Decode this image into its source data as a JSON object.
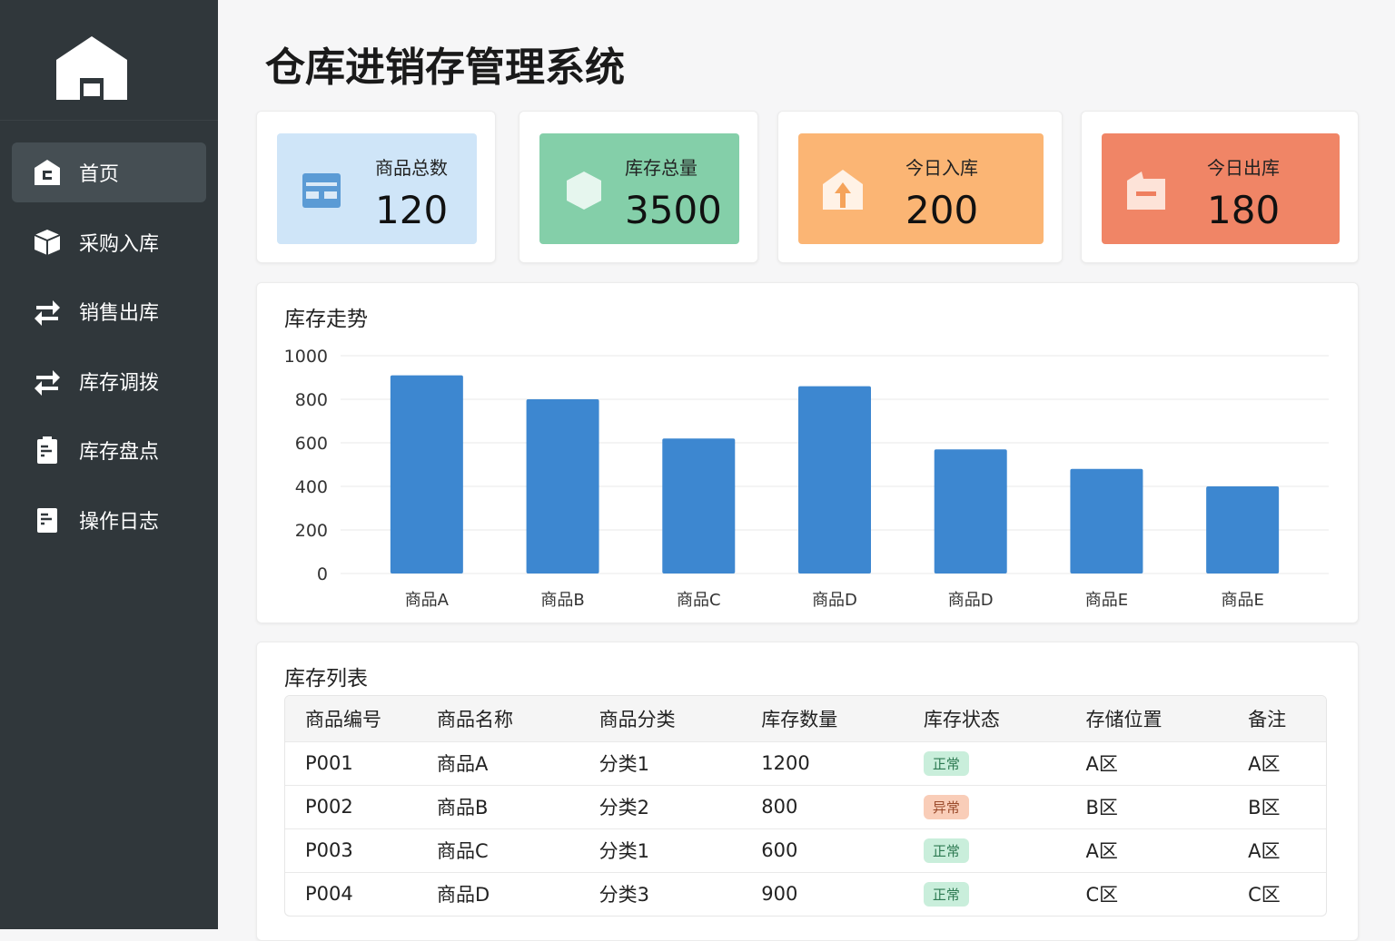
{
  "app": {
    "title": "仓库进销存管理系统"
  },
  "sidebar": {
    "items": [
      {
        "label": "首页",
        "icon": "home-icon"
      },
      {
        "label": "采购入库",
        "icon": "box-icon"
      },
      {
        "label": "销售出库",
        "icon": "transfer-icon"
      },
      {
        "label": "库存调拨",
        "icon": "transfer-icon"
      },
      {
        "label": "库存盘点",
        "icon": "clipboard-icon"
      },
      {
        "label": "操作日志",
        "icon": "document-icon"
      }
    ]
  },
  "stats": [
    {
      "label": "商品总数",
      "value": "120",
      "color": "#cfe5f8"
    },
    {
      "label": "库存总量",
      "value": "3500",
      "color": "#84cfa9"
    },
    {
      "label": "今日入库",
      "value": "200",
      "color": "#fbb574"
    },
    {
      "label": "今日出库",
      "value": "180",
      "color": "#f08566"
    }
  ],
  "chart_data": {
    "type": "bar",
    "title": "库存走势",
    "categories": [
      "商品A",
      "商品B",
      "商品C",
      "商品D",
      "商品D",
      "商品E",
      "商品E"
    ],
    "values": [
      910,
      800,
      620,
      860,
      570,
      480,
      400
    ],
    "yticks": [
      "0",
      "200",
      "400",
      "600",
      "800",
      "1000"
    ],
    "ylim": [
      0,
      1000
    ],
    "color": "#3d87d0",
    "grid": true
  },
  "inventory": {
    "title": "库存列表",
    "columns": [
      "商品编号",
      "商品名称",
      "商品分类",
      "库存数量",
      "库存状态",
      "存储位置",
      "备注"
    ],
    "rows": [
      {
        "id": "P001",
        "name": "商品A",
        "category": "分类1",
        "qty": "1200",
        "status": "正常",
        "status_type": "ok",
        "location": "A区",
        "note": "A区"
      },
      {
        "id": "P002",
        "name": "商品B",
        "category": "分类2",
        "qty": "800",
        "status": "异常",
        "status_type": "bad",
        "location": "B区",
        "note": "B区"
      },
      {
        "id": "P003",
        "name": "商品C",
        "category": "分类1",
        "qty": "600",
        "status": "正常",
        "status_type": "ok",
        "location": "A区",
        "note": "A区"
      },
      {
        "id": "P004",
        "name": "商品D",
        "category": "分类3",
        "qty": "900",
        "status": "正常",
        "status_type": "ok",
        "location": "C区",
        "note": "C区"
      }
    ]
  }
}
